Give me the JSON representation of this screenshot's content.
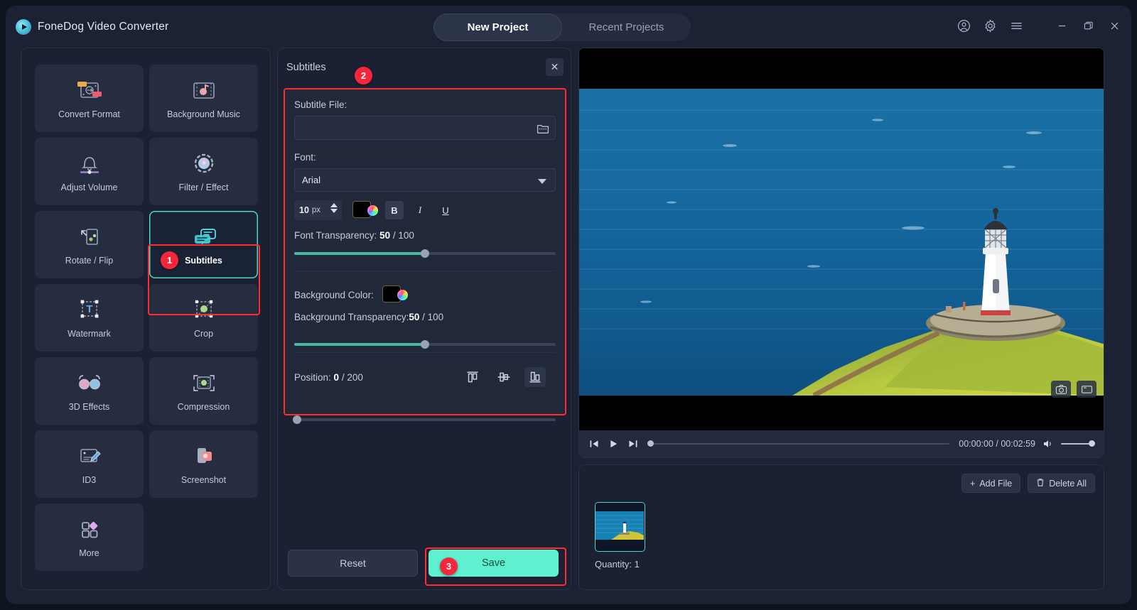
{
  "app": {
    "brand": "FoneDog Video Converter",
    "logo_icon": "play-circle-icon"
  },
  "tabs": [
    {
      "label": "New Project",
      "active": true
    },
    {
      "label": "Recent Projects",
      "active": false
    }
  ],
  "window_controls": [
    {
      "name": "account-icon",
      "glyph": "account"
    },
    {
      "name": "settings-gear-icon",
      "glyph": "gear"
    },
    {
      "name": "menu-icon",
      "glyph": "hamburger"
    },
    {
      "name": "minimize-button",
      "glyph": "minimize"
    },
    {
      "name": "maximize-button",
      "glyph": "maximize"
    },
    {
      "name": "close-button",
      "glyph": "close"
    }
  ],
  "tools": [
    {
      "label": "Convert Format",
      "icon": "convert-format-icon",
      "selected": false
    },
    {
      "label": "Background Music",
      "icon": "background-music-icon",
      "selected": false
    },
    {
      "label": "Adjust Volume",
      "icon": "adjust-volume-icon",
      "selected": false
    },
    {
      "label": "Filter / Effect",
      "icon": "filter-effect-icon",
      "selected": false
    },
    {
      "label": "Rotate / Flip",
      "icon": "rotate-flip-icon",
      "selected": false
    },
    {
      "label": "Subtitles",
      "icon": "subtitles-icon",
      "selected": true
    },
    {
      "label": "Watermark",
      "icon": "watermark-icon",
      "selected": false
    },
    {
      "label": "Crop",
      "icon": "crop-icon",
      "selected": false
    },
    {
      "label": "3D Effects",
      "icon": "3d-effects-icon",
      "selected": false
    },
    {
      "label": "Compression",
      "icon": "compression-icon",
      "selected": false
    },
    {
      "label": "ID3",
      "icon": "id3-icon",
      "selected": false
    },
    {
      "label": "Screenshot",
      "icon": "screenshot-icon",
      "selected": false
    },
    {
      "label": "More",
      "icon": "more-icon",
      "selected": false
    }
  ],
  "steps": {
    "one": "1",
    "two": "2",
    "three": "3"
  },
  "settings": {
    "title": "Subtitles",
    "close_label": "✕",
    "subtitle_file": {
      "label": "Subtitle File:",
      "value": "",
      "placeholder": "",
      "browse_icon": "folder-icon"
    },
    "font": {
      "label": "Font:",
      "value": "Arial",
      "options": [
        "Arial"
      ],
      "size": "10",
      "size_unit": "px",
      "color": "#000000",
      "bold_label": "B",
      "italic_label": "I",
      "underline_label": "U",
      "bold_active": true
    },
    "font_transparency": {
      "label": "Font Transparency:",
      "value": "50",
      "max_label": "/ 100",
      "value_num": 50,
      "max": 100
    },
    "background_color": {
      "label": "Background Color:",
      "color": "#000000"
    },
    "background_transparency": {
      "label": "Background Transparency:",
      "value": "50",
      "max_label": "/ 100",
      "value_num": 50,
      "max": 100
    },
    "position": {
      "label": "Position:",
      "value": "0",
      "max_label": "/ 200",
      "value_num": 0,
      "max": 200,
      "alignments": [
        {
          "name": "align-top-icon",
          "active": false
        },
        {
          "name": "align-middle-icon",
          "active": false
        },
        {
          "name": "align-bottom-icon",
          "active": true
        }
      ]
    },
    "reset_label": "Reset",
    "save_label": "Save"
  },
  "preview": {
    "controls": {
      "prev_icon": "skip-back-icon",
      "play_icon": "play-icon",
      "next_icon": "skip-forward-icon",
      "current_time": "00:00:00",
      "separator": "/",
      "total_time": "00:02:59",
      "timecode": "00:00:00 / 00:02:59",
      "volume_icon": "volume-icon",
      "seek_percent": 0,
      "volume_percent": 88
    },
    "overlay_buttons": [
      {
        "name": "snapshot-camera-icon"
      },
      {
        "name": "fullscreen-icon"
      }
    ]
  },
  "filelist": {
    "add_file_label": "Add File",
    "add_file_icon": "plus-icon",
    "delete_all_label": "Delete All",
    "delete_all_icon": "trash-icon",
    "quantity_label": "Quantity: 1",
    "thumbnail_name": "lighthouse-video-thumbnail"
  },
  "colors": {
    "accent_teal": "#5ff0d0",
    "highlight_red": "#ff2d2d",
    "badge_red": "#f8263a",
    "slider_green": "#49b89f",
    "panel_bg": "#1b2132",
    "app_bg": "#1c2233"
  }
}
